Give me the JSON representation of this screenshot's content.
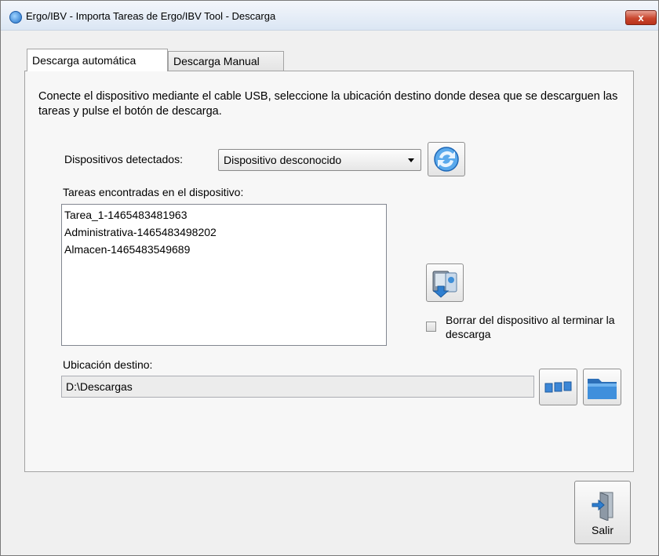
{
  "window": {
    "title": "Ergo/IBV - Importa Tareas de Ergo/IBV Tool - Descarga",
    "close_label": "x"
  },
  "tabs": [
    {
      "label": "Descarga automática",
      "active": true
    },
    {
      "label": "Descarga Manual",
      "active": false
    }
  ],
  "main": {
    "instructions": "Conecte el dispositivo mediante el cable USB, seleccione la ubicación destino donde desea que se descarguen las tareas y pulse el botón de descarga.",
    "devices_label": "Dispositivos detectados:",
    "device_selected": "Dispositivo desconocido",
    "tasks_label": "Tareas encontradas en el dispositivo:",
    "tasks": [
      "Tarea_1-1465483481963",
      "Administrativa-1465483498202",
      "Almacen-1465483549689"
    ],
    "delete_checkbox_label": "Borrar del dispositivo al terminar la descarga",
    "delete_checked": false,
    "destination_label": "Ubicación destino:",
    "destination_path": "D:\\Descargas"
  },
  "footer": {
    "exit_label": "Salir"
  },
  "icons": {
    "refresh": "refresh-icon",
    "download": "download-device-icon",
    "browse": "dots-icon",
    "folder": "folder-icon",
    "exit": "exit-door-icon"
  },
  "colors": {
    "accent_blue": "#2a7fd4",
    "close_red": "#c9462e"
  }
}
